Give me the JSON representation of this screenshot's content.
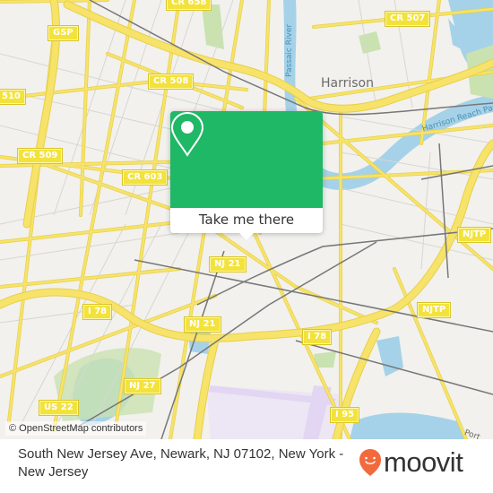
{
  "map": {
    "colors": {
      "background": "#f2f1ed",
      "road_major": "#f7e36a",
      "road_outline": "#e0c94a",
      "road_minor": "#ffffff",
      "water": "#a5d2e8",
      "park": "#c9e2b0",
      "rail": "#777777",
      "airport": "#e2d6f2"
    },
    "place_labels": [
      "Harrison"
    ],
    "water_labels": [
      "Passaic River",
      "Harrison Reach Passaic"
    ],
    "small_label": "Port",
    "route_shields": [
      "CR 658",
      "GSP",
      "CR 507",
      "CR 508",
      "510",
      "CR 509",
      "CR 603",
      "NJ 21",
      "NJTP",
      "I 78",
      "NJ 21",
      "NJTP",
      "I 78",
      "NJ 27",
      "US 22",
      "I 95"
    ]
  },
  "popup": {
    "accent": "#1fb866",
    "icon": "map-pin-icon",
    "button_label": "Take me there"
  },
  "attribution": "© OpenStreetMap contributors",
  "footer": {
    "address": "South New Jersey Ave, Newark, NJ 07102, New York - New Jersey",
    "logo_text": "moovit",
    "logo_color": "#f26a3c"
  }
}
